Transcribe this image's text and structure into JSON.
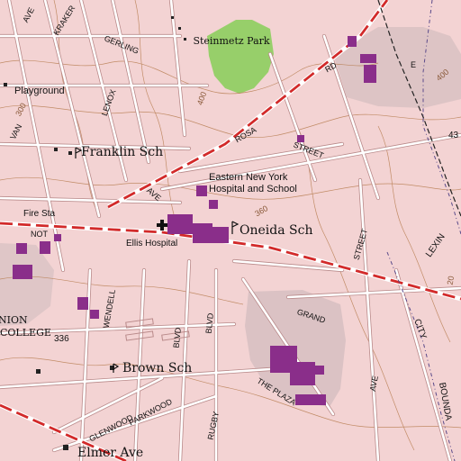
{
  "colors": {
    "background": "#f3d3d3",
    "street_line": "#ffffff",
    "street_casing": "#b98a8a",
    "contour": "#b57a4c",
    "park": "#97cf6a",
    "building": "#8a2e8a",
    "major_road": "#d22a2a",
    "water_grey": "#c7b5b8",
    "boundary": "#5a4a8a",
    "railroad": "#222222"
  },
  "labels": {
    "steinmetz_park": "Steinmetz Park",
    "playground": "Playground",
    "franklin_sch": "Franklin Sch",
    "eastern_ny_hospital_1": "Eastern New York",
    "eastern_ny_hospital_2": "Hospital and School",
    "fire_sta": "Fire Sta",
    "ellis_hospital": "Ellis Hospital",
    "oneida_sch": "Oneida Sch",
    "union_college_1": "NION",
    "union_college_2": "COLLEGE",
    "elev_336": "336",
    "brown_sch": "Brown Sch",
    "elmer_ave": "Elmer Ave",
    "gerling": "GERLING",
    "kraker": "KRAKER",
    "van_vranken": "VAN",
    "lenox": "LENOX",
    "rosa": "ROSA",
    "rd": "RD",
    "street_upper": "STREET",
    "street_right": "STREET",
    "grand": "GRAND",
    "the_plaza": "THE PLAZA",
    "ave_upper": "AVE",
    "ave_top_left": "AVE",
    "blvd_1": "BLVD",
    "blvd_2": "BLVD",
    "wendell": "WENDELL",
    "glenwood": "GLENWOOD",
    "parkwood": "PARKWOOD",
    "rugby": "RUGBY",
    "ave_right": "AVE",
    "city": "CITY",
    "boundary": "BOUNDA",
    "lexington": "LEXIN",
    "not": "NOT",
    "contour_300": "300",
    "contour_400_a": "400",
    "contour_400_b": "400",
    "contour_360": "360",
    "elev_43": "43",
    "elev_20": "20",
    "map_letter_e": "E"
  }
}
